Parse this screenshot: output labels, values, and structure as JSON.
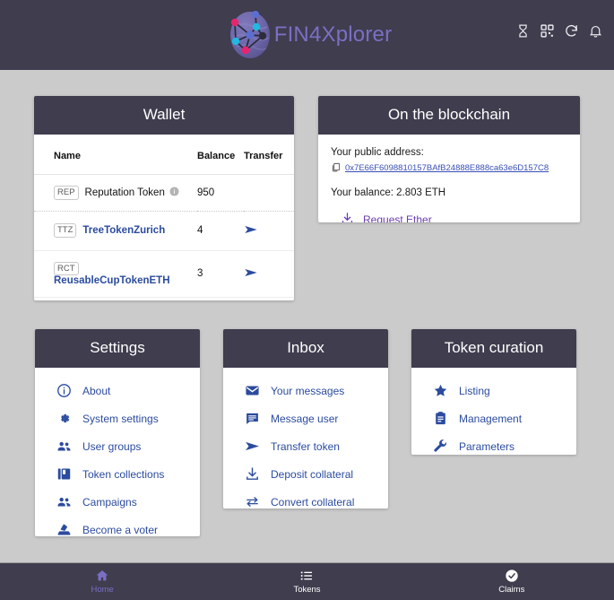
{
  "header": {
    "brand": "FIN4Xplorer",
    "logo_icon": "network-globe-logo",
    "icons": [
      {
        "name": "hourglass-icon",
        "label": "Pending transactions"
      },
      {
        "name": "qr-code-icon",
        "label": "QR code"
      },
      {
        "name": "refresh-icon",
        "label": "Refresh"
      },
      {
        "name": "bell-icon",
        "label": "Notifications"
      }
    ]
  },
  "wallet": {
    "title": "Wallet",
    "columns": [
      "Name",
      "Balance",
      "Transfer"
    ],
    "rows": [
      {
        "symbol": "REP",
        "name": "Reputation Token",
        "balance": "950",
        "info_icon": "info-icon",
        "transfer_icon": "",
        "is_link": false
      },
      {
        "symbol": "TTZ",
        "name": "TreeTokenZurich",
        "balance": "4",
        "info_icon": "",
        "transfer_icon": "send-icon",
        "is_link": true
      },
      {
        "symbol": "RCT",
        "name": "ReusableCupTokenETH",
        "balance": "3",
        "info_icon": "",
        "transfer_icon": "send-icon",
        "is_link": true
      }
    ]
  },
  "blockchain": {
    "title": "On the blockchain",
    "address_label": "Your public address:",
    "copy_icon": "copy-icon",
    "address": "0x7E66F6098810157BAfB24888E888ca63e6D157C8",
    "balance_text": "Your balance: 2.803 ETH",
    "request_ether_icon": "download-icon",
    "request_ether_label": "Request Ether"
  },
  "settings": {
    "title": "Settings",
    "items": [
      {
        "icon": "info-circle-icon",
        "label": "About"
      },
      {
        "icon": "gear-icon",
        "label": "System settings"
      },
      {
        "icon": "people-icon",
        "label": "User groups"
      },
      {
        "icon": "collections-icon",
        "label": "Token collections"
      },
      {
        "icon": "people-icon",
        "label": "Campaigns"
      },
      {
        "icon": "how-to-vote-icon",
        "label": "Become a voter"
      }
    ]
  },
  "inbox": {
    "title": "Inbox",
    "items": [
      {
        "icon": "envelope-icon",
        "label": "Your messages"
      },
      {
        "icon": "chat-icon",
        "label": "Message user"
      },
      {
        "icon": "send-icon",
        "label": "Transfer token"
      },
      {
        "icon": "download-icon",
        "label": "Deposit collateral"
      },
      {
        "icon": "swap-horizontal-icon",
        "label": "Convert collateral"
      }
    ]
  },
  "curation": {
    "title": "Token curation",
    "items": [
      {
        "icon": "star-icon",
        "label": "Listing"
      },
      {
        "icon": "clipboard-icon",
        "label": "Management"
      },
      {
        "icon": "wrench-icon",
        "label": "Parameters"
      }
    ]
  },
  "bottom_nav": {
    "items": [
      {
        "icon": "home-icon",
        "label": "Home",
        "active": true
      },
      {
        "icon": "list-icon",
        "label": "Tokens",
        "active": false
      },
      {
        "icon": "check-circle-icon",
        "label": "Claims",
        "active": false
      }
    ]
  },
  "colors": {
    "app_background": "#cbcbcb",
    "bar_background": "#3f3d4e",
    "brand_purple": "#7a6fc4",
    "link_blue": "#2b4b9e",
    "address_blue": "#3a4fb5",
    "ether_purple": "#6a3ab2",
    "card_white": "#ffffff"
  }
}
